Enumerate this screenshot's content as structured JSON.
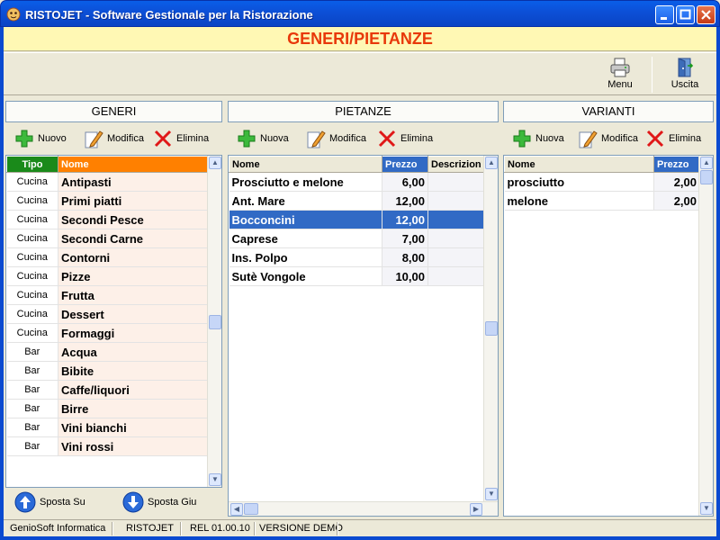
{
  "window": {
    "title": "RISTOJET - Software Gestionale per la Ristorazione"
  },
  "banner": "GENERI/PIETANZE",
  "toolbar": {
    "menu": "Menu",
    "uscita": "Uscita"
  },
  "generi": {
    "title": "GENERI",
    "buttons": {
      "nuovo": "Nuovo",
      "modifica": "Modifica",
      "elimina": "Elimina"
    },
    "columns": {
      "tipo": "Tipo",
      "nome": "Nome"
    },
    "rows": [
      {
        "tipo": "Cucina",
        "nome": "Antipasti"
      },
      {
        "tipo": "Cucina",
        "nome": "Primi piatti"
      },
      {
        "tipo": "Cucina",
        "nome": "Secondi Pesce"
      },
      {
        "tipo": "Cucina",
        "nome": "Secondi Carne"
      },
      {
        "tipo": "Cucina",
        "nome": "Contorni"
      },
      {
        "tipo": "Cucina",
        "nome": "Pizze"
      },
      {
        "tipo": "Cucina",
        "nome": "Frutta"
      },
      {
        "tipo": "Cucina",
        "nome": "Dessert"
      },
      {
        "tipo": "Cucina",
        "nome": "Formaggi"
      },
      {
        "tipo": "Bar",
        "nome": "Acqua"
      },
      {
        "tipo": "Bar",
        "nome": "Bibite"
      },
      {
        "tipo": "Bar",
        "nome": "Caffe/liquori"
      },
      {
        "tipo": "Bar",
        "nome": "Birre"
      },
      {
        "tipo": "Bar",
        "nome": "Vini bianchi"
      },
      {
        "tipo": "Bar",
        "nome": "Vini rossi"
      }
    ],
    "sposta_su": "Sposta Su",
    "sposta_giu": "Sposta Giu"
  },
  "pietanze": {
    "title": "PIETANZE",
    "buttons": {
      "nuova": "Nuova",
      "modifica": "Modifica",
      "elimina": "Elimina"
    },
    "columns": {
      "nome": "Nome",
      "prezzo": "Prezzo",
      "descrizione": "Descrizion"
    },
    "rows": [
      {
        "nome": "Prosciutto e melone",
        "prezzo": "6,00",
        "descrizione": ""
      },
      {
        "nome": "Ant. Mare",
        "prezzo": "12,00",
        "descrizione": ""
      },
      {
        "nome": "Bocconcini",
        "prezzo": "12,00",
        "descrizione": ""
      },
      {
        "nome": "Caprese",
        "prezzo": "7,00",
        "descrizione": ""
      },
      {
        "nome": "Ins. Polpo",
        "prezzo": "8,00",
        "descrizione": ""
      },
      {
        "nome": "Sutè Vongole",
        "prezzo": "10,00",
        "descrizione": ""
      }
    ],
    "selected_row": 2
  },
  "varianti": {
    "title": "VARIANTI",
    "buttons": {
      "nuova": "Nuova",
      "modifica": "Modifica",
      "elimina": "Elimina"
    },
    "columns": {
      "nome": "Nome",
      "prezzo": "Prezzo"
    },
    "rows": [
      {
        "nome": "prosciutto",
        "prezzo": "2,00"
      },
      {
        "nome": "melone",
        "prezzo": "2,00"
      }
    ]
  },
  "status": {
    "company": "GenioSoft Informatica",
    "app": "RISTOJET",
    "release": "REL 01.00.10",
    "version": "VERSIONE DEMO"
  },
  "colors": {
    "title_blue": "#0a5ee8",
    "banner_bg": "#fff8b4",
    "banner_text": "#e8380a",
    "tipo_header": "#1a8a1a",
    "nome_header": "#ff8000",
    "selection": "#316ac5",
    "price_header": "#316ac5"
  }
}
